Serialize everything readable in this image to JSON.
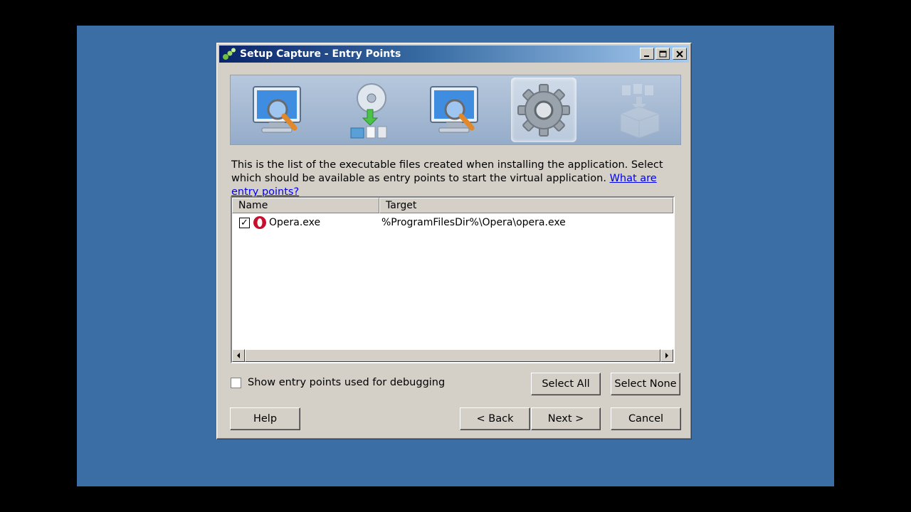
{
  "window": {
    "title": "Setup Capture - Entry Points",
    "controls": {
      "minimize": "_",
      "maximize": "□",
      "close": "✕"
    }
  },
  "wizard_steps": [
    {
      "icon": "monitor-scan-icon",
      "active": false
    },
    {
      "icon": "disc-install-icon",
      "active": false
    },
    {
      "icon": "monitor-scan-icon",
      "active": false
    },
    {
      "icon": "gear-icon",
      "active": true
    },
    {
      "icon": "package-icon",
      "active": false
    }
  ],
  "description": {
    "text": "This is the list of the executable files created when installing the application. Select which should be available as entry points to start the virtual application.",
    "link": "What are entry points?"
  },
  "list": {
    "columns": [
      "Name",
      "Target"
    ],
    "rows": [
      {
        "checked": true,
        "icon": "opera-icon",
        "name": "Opera.exe",
        "target": "%ProgramFilesDir%\\Opera\\opera.exe"
      }
    ]
  },
  "debug_checkbox": {
    "label": "Show entry points used for debugging",
    "checked": false
  },
  "buttons": {
    "select_all": "Select All",
    "select_none": "Select None",
    "help": "Help",
    "back": "< Back",
    "next": "Next >",
    "cancel": "Cancel"
  },
  "colors": {
    "desktop": "#3a6ea5",
    "window_face": "#d4d0c8",
    "titlebar_start": "#0a246a",
    "link": "#0000ee"
  }
}
